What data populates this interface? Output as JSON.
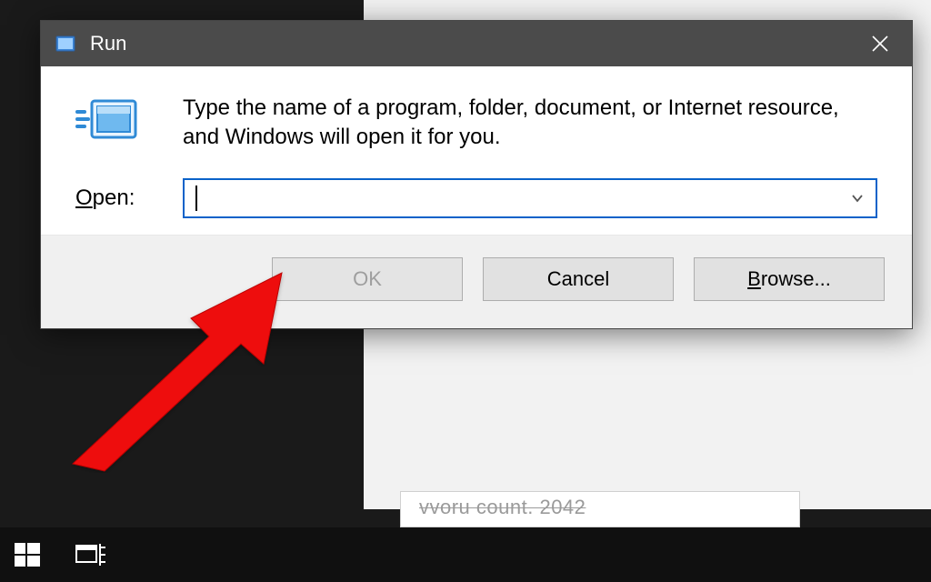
{
  "dialog": {
    "title": "Run",
    "description": "Type the name of a program, folder, document, or Internet resource, and Windows will open it for you.",
    "open_label_pre": "O",
    "open_label_rest": "pen:",
    "input_value": "",
    "buttons": {
      "ok": "OK",
      "cancel": "Cancel",
      "browse_pre": "B",
      "browse_rest": "rowse..."
    }
  },
  "background": {
    "partial_text": "vvoru count. 2042"
  }
}
